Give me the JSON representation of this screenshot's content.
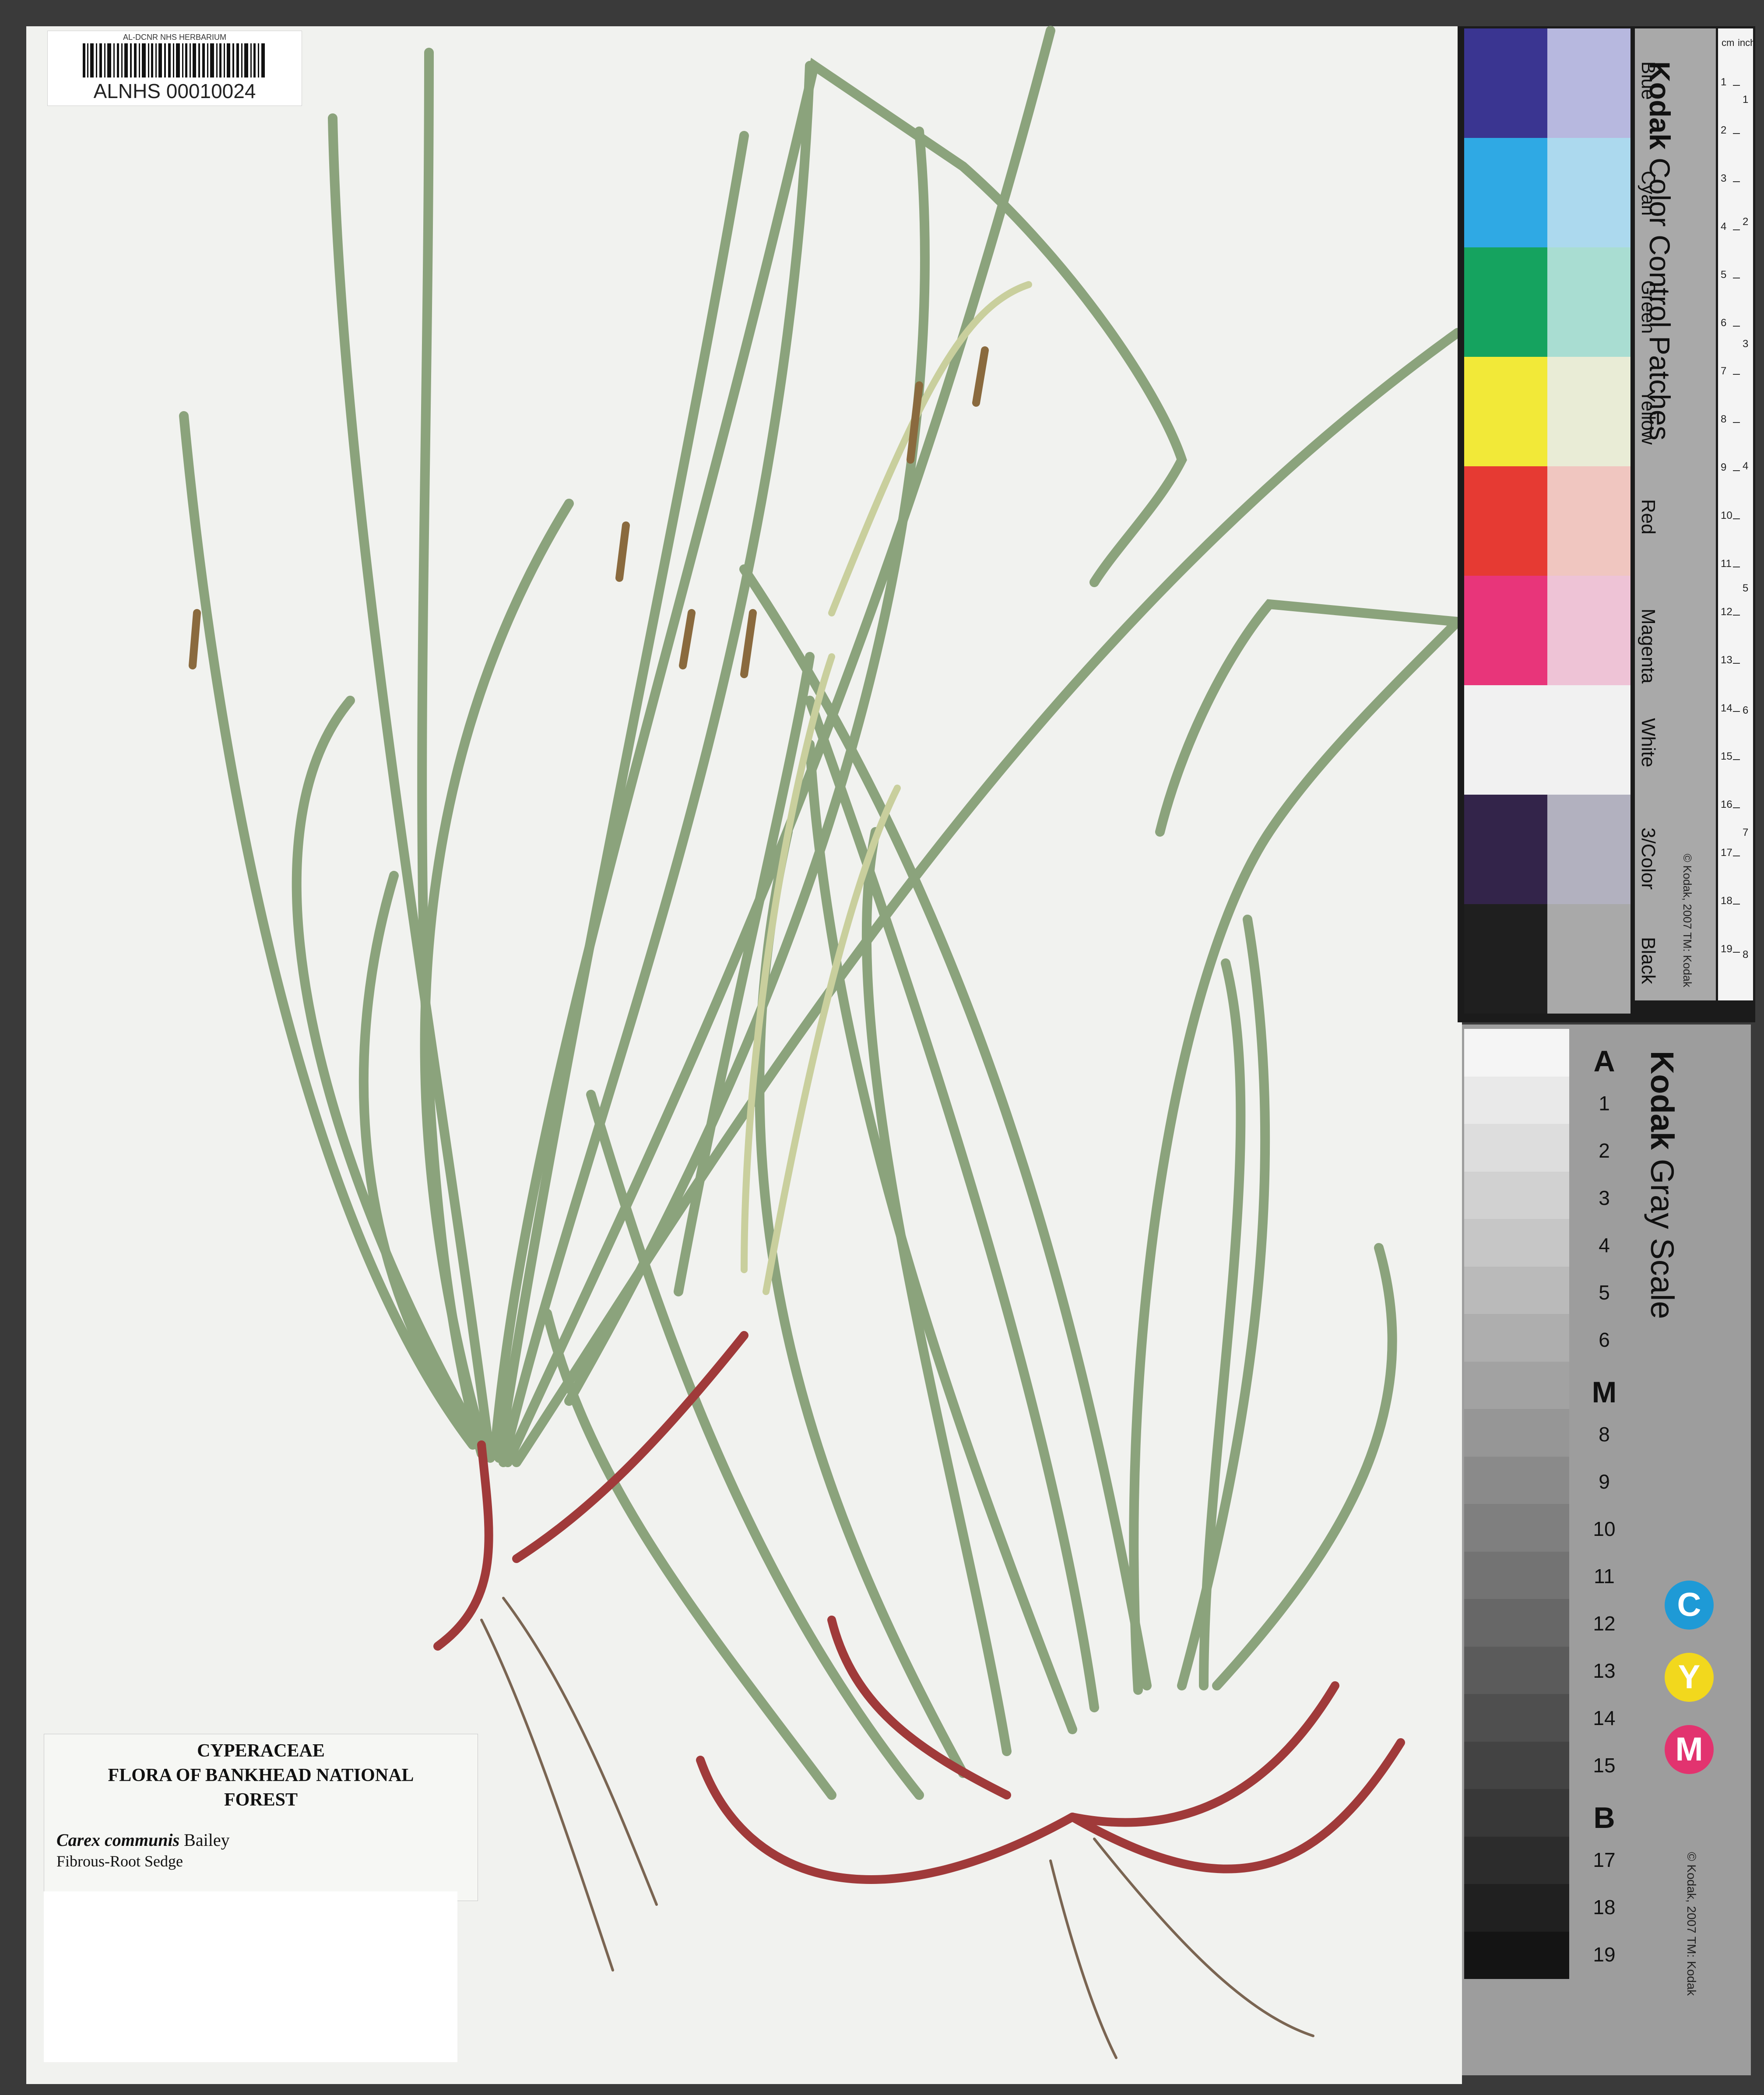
{
  "barcode": {
    "herbarium": "AL-DCNR NHS HERBARIUM",
    "catalog_number": "ALNHS 00010024"
  },
  "label": {
    "family": "CYPERACEAE",
    "flora": "FLORA OF BANKHEAD NATIONAL FOREST",
    "species": "Carex communis",
    "author": "Bailey",
    "common_name": "Fibrous-Root Sedge"
  },
  "color_card": {
    "brand": "Kodak",
    "title": "Color Control Patches",
    "patches": [
      {
        "name": "Blue",
        "dark": "#3a3591",
        "light": "#b7b8df"
      },
      {
        "name": "Cyan",
        "dark": "#2fa9e4",
        "light": "#acd9ee"
      },
      {
        "name": "Green",
        "dark": "#15a35f",
        "light": "#a9ddd2"
      },
      {
        "name": "Yellow",
        "dark": "#f2e938",
        "light": "#e9ecd6"
      },
      {
        "name": "Red",
        "dark": "#e63a33",
        "light": "#f0c6c0"
      },
      {
        "name": "Magenta",
        "dark": "#e8357a",
        "light": "#eec3d6"
      },
      {
        "name": "White",
        "dark": "#f1f1f1",
        "light": "#f1f1f1"
      },
      {
        "name": "3/Color",
        "dark": "#33244a",
        "light": "#b2b1bf"
      },
      {
        "name": "Black",
        "dark": "#1f1f1f",
        "light": "#a9a9a9"
      }
    ],
    "copyright": "© Kodak, 2007 TM: Kodak",
    "ruler_unit_top": "inches",
    "ruler_unit_cm": "cm",
    "ruler_cm": [
      "1",
      "2",
      "3",
      "4",
      "5",
      "6",
      "7",
      "8",
      "9",
      "10",
      "11",
      "12",
      "13",
      "14",
      "15",
      "16",
      "17",
      "18",
      "19"
    ],
    "ruler_inches": [
      "1",
      "2",
      "3",
      "4",
      "5",
      "6",
      "7",
      "8"
    ]
  },
  "gray_scale": {
    "brand": "Kodak",
    "title": "Gray Scale",
    "steps": [
      "A",
      "1",
      "2",
      "3",
      "4",
      "5",
      "6",
      "M",
      "8",
      "9",
      "10",
      "11",
      "12",
      "13",
      "14",
      "15",
      "B",
      "17",
      "18",
      "19"
    ],
    "cym": [
      {
        "letter": "C",
        "color": "#1e9ad6"
      },
      {
        "letter": "Y",
        "color": "#f2d81d"
      },
      {
        "letter": "M",
        "color": "#e2336f"
      }
    ],
    "copyright": "© Kodak, 2007 TM: Kodak"
  }
}
